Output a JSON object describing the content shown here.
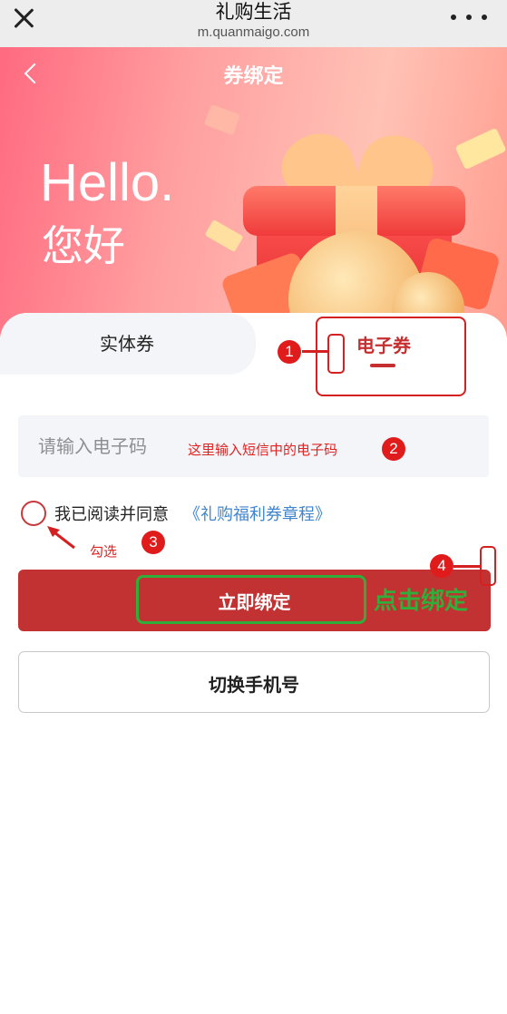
{
  "browser": {
    "site_name": "礼购生活",
    "url": "m.quanmaigo.com"
  },
  "hero": {
    "title": "券绑定",
    "hello": "Hello.",
    "greeting": "您好"
  },
  "tabs": [
    {
      "label": "实体券",
      "active": false
    },
    {
      "label": "电子券",
      "active": true
    }
  ],
  "form": {
    "code_placeholder": "请输入电子码",
    "agree_text": "我已阅读并同意",
    "agree_link": "《礼购福利券章程》",
    "bind_button": "立即绑定",
    "switch_button": "切换手机号"
  },
  "annotations": {
    "badges": [
      "1",
      "2",
      "3",
      "4"
    ],
    "note_code": "这里输入短信中的电子码",
    "note_check": "勾选",
    "note_click": "点击绑定"
  },
  "colors": {
    "primary": "#c23233",
    "link": "#3f86ce",
    "annotation_red": "#d42020",
    "annotation_green": "#2fae3a"
  }
}
